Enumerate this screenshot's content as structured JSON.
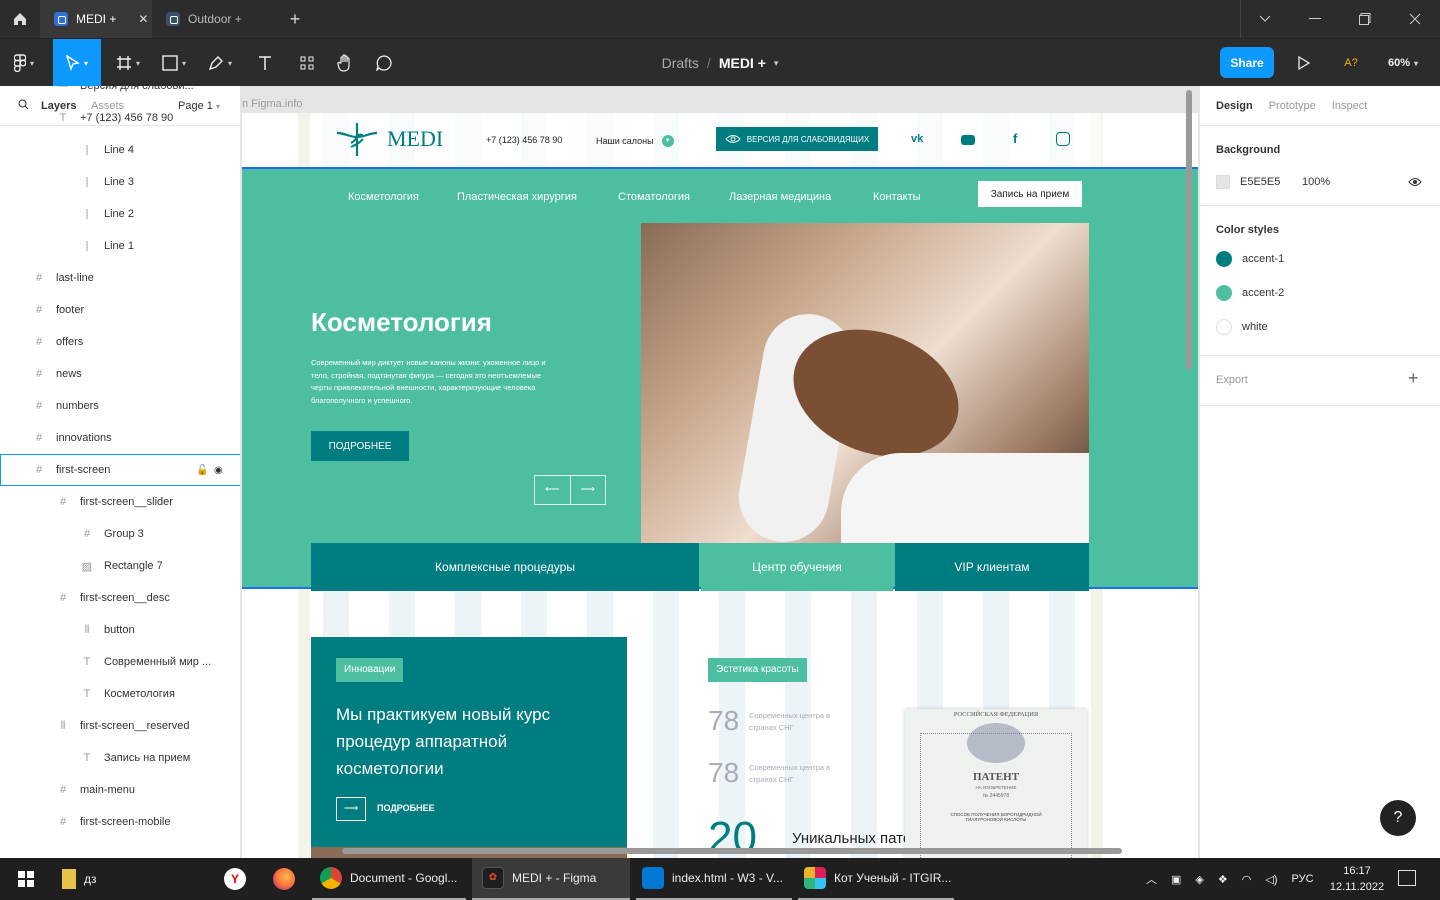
{
  "tabs": [
    {
      "label": "MEDI +"
    },
    {
      "label": "Outdoor +"
    }
  ],
  "toolbar": {
    "breadcrumb_root": "Drafts",
    "breadcrumb_sep": "/",
    "file_name": "MEDI +",
    "share": "Share",
    "font_missing": "A?",
    "zoom": "60%"
  },
  "left_panel": {
    "tab_layers": "Layers",
    "tab_assets": "Assets",
    "page": "Page 1",
    "layers": [
      "Версия для слабови...",
      "+7 (123) 456 78 90",
      "Line 4",
      "Line 3",
      "Line 2",
      "Line 1",
      "last-line",
      "footer",
      "offers",
      "news",
      "numbers",
      "innovations",
      "first-screen",
      "first-screen__slider",
      "Group 3",
      "Rectangle 7",
      "first-screen__desc",
      "button",
      "Современный мир ...",
      "Косметология",
      "first-screen__reserved",
      "Запись на прием",
      "main-menu",
      "first-screen-mobile"
    ]
  },
  "right_panel": {
    "tab_design": "Design",
    "tab_prototype": "Prototype",
    "tab_inspect": "Inspect",
    "background_title": "Background",
    "bg_hex": "E5E5E5",
    "bg_opacity": "100%",
    "color_styles_title": "Color styles",
    "color_styles": [
      {
        "name": "accent-1",
        "color": "#007d80"
      },
      {
        "name": "accent-2",
        "color": "#4dbfa0"
      },
      {
        "name": "white",
        "color": "#ffffff"
      }
    ],
    "export": "Export"
  },
  "canvas": {
    "frame_label": "n Figma.info",
    "site": {
      "logo": "MEDI",
      "phone": "+7 (123) 456 78 90",
      "salons": "Наши салоны",
      "vision": "ВЕРСИЯ ДЛЯ СЛАБОВИДЯЩИХ",
      "menu": [
        "Косметология",
        "Пластическая хирургия",
        "Стоматология",
        "Лазерная медицина",
        "Контакты"
      ],
      "book": "Запись на прием",
      "hero_title": "Косметология",
      "hero_text": "Современный мир диктует новые каноны жизни: ухоженное лицо и тело, стройная, подтянутая фигура — сегодня это неотъемлемые черты привлекательной внешности, характеризующие человека благополучного и успешного.",
      "more": "ПОДРОБНЕЕ",
      "strip": [
        "Комплексные процедуры",
        "Центр обучения",
        "VIP клиентам"
      ],
      "innov_tag": "Инновации",
      "innov_text": "Мы практикуем новый курс процедур аппаратной косметологии",
      "innov_more": "ПОДРОБНЕЕ",
      "beauty_tag": "Эстетика красоты",
      "stats": [
        {
          "num": "78",
          "text": "Современных центра в странах СНГ"
        },
        {
          "num": "78",
          "text": "Современных центра в странах СНГ"
        }
      ],
      "patents_num": "20",
      "patents_label": "Уникальных патентов",
      "patent_doc": {
        "country": "РОССИЙСКАЯ ФЕДЕРАЦИЯ",
        "title": "ПАТЕНТ",
        "sub": "НА ИЗОБРЕТЕНИЕ",
        "number": "№ 2445978",
        "desc": "СПОСОБ ПОЛУЧЕНИЯ БОРОГИДРИДНОЙ ГИАЛУРОНОВОЙ КИСЛОТЫ"
      }
    }
  },
  "taskbar": {
    "folder": "дз",
    "chrome": "Document - Googl...",
    "figma": "MEDI + - Figma",
    "vscode": "index.html - W3 - V...",
    "slack": "Кот Ученый - ITGIR...",
    "lang": "РУС",
    "time": "16:17",
    "date": "12.11.2022"
  },
  "help": "?"
}
